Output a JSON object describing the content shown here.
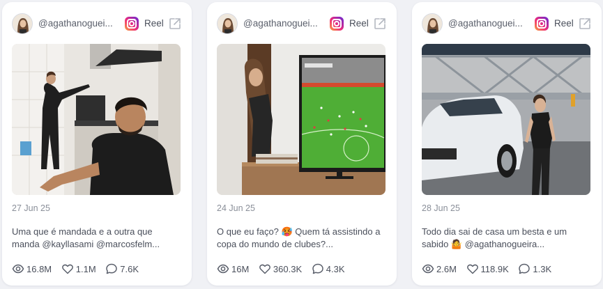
{
  "cards": [
    {
      "handle": "@agathanoguei...",
      "platform": "instagram",
      "type_label": "Reel",
      "date": "27 Jun 25",
      "caption_lines": [
        "Uma que é mandada e a outra que",
        "manda @kayllasami @marcosfelm..."
      ],
      "views": "16.8M",
      "likes": "1.1M",
      "comments": "7.6K",
      "thumbnail": "woman at kitchen cabinet, man in black shirt in foreground"
    },
    {
      "handle": "@agathanoguei...",
      "platform": "instagram",
      "type_label": "Reel",
      "date": "24 Jun 25",
      "caption_lines": [
        "O que eu faço? 🥵 Quem tá assistindo a",
        "copa do mundo de clubes?..."
      ],
      "views": "16M",
      "likes": "360.3K",
      "comments": "4.3K",
      "thumbnail": "woman peeking from door, TV showing football match"
    },
    {
      "handle": "@agathanoguei...",
      "platform": "instagram",
      "type_label": "Reel",
      "date": "28 Jun 25",
      "caption_lines": [
        "Todo dia sai de casa um besta e um",
        "sabido 🤷 @agathanogueira..."
      ],
      "views": "2.6M",
      "likes": "118.9K",
      "comments": "1.3K",
      "thumbnail": "woman walking beside white car in parking lot"
    }
  ],
  "colors": {
    "card_bg": "#ffffff",
    "page_bg": "#f0f1f5",
    "text": "#4a4f5b",
    "muted": "#8a8f99"
  },
  "icons": [
    "avatar",
    "instagram-icon",
    "external-link-icon",
    "eye-icon",
    "heart-icon",
    "comment-icon"
  ]
}
